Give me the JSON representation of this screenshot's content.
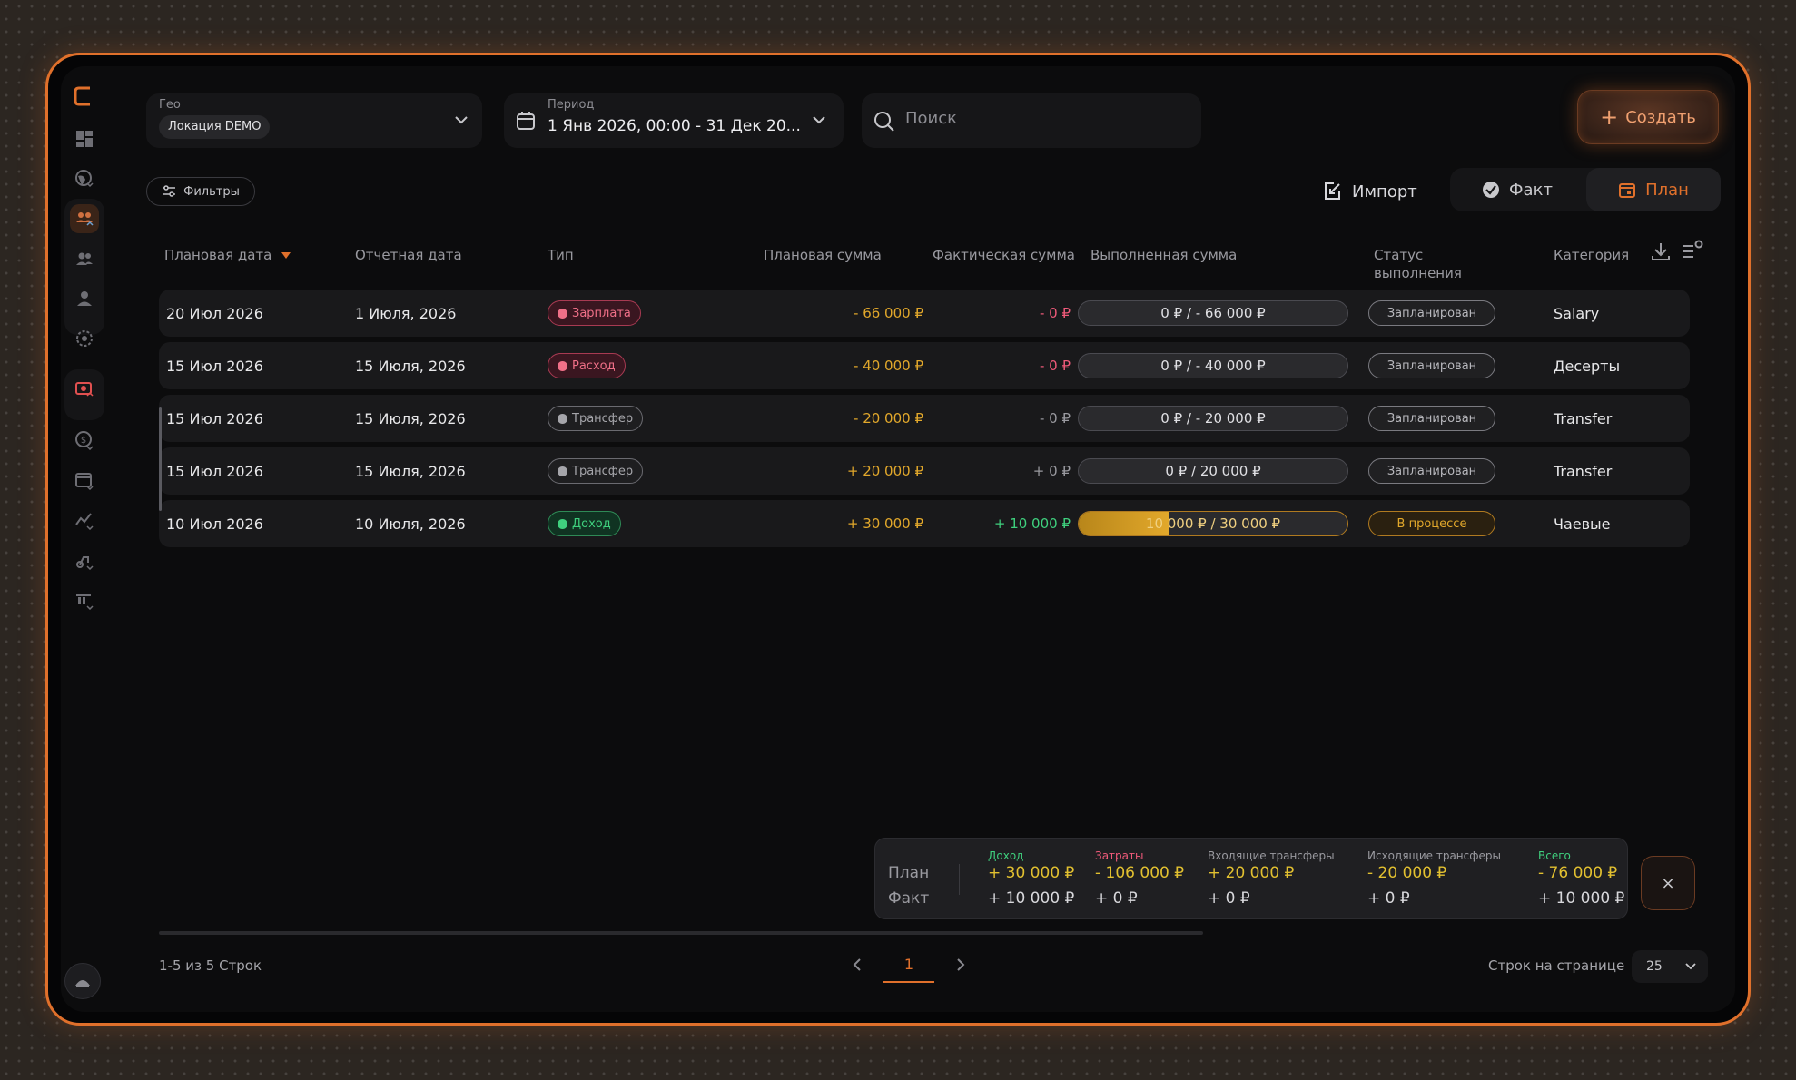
{
  "header": {
    "geo": {
      "label": "Гео",
      "value": "Локация DEMO"
    },
    "period": {
      "label": "Период",
      "value": "1 Янв 2026, 00:00 - 31 Дек 20..."
    },
    "search": {
      "placeholder": "Поиск"
    },
    "create_label": "Создать"
  },
  "toolbar": {
    "filters_label": "Фильтры",
    "import_label": "Импорт",
    "fact_label": "Факт",
    "plan_label": "План",
    "active_mode": "План"
  },
  "table": {
    "headers": {
      "plan_date": "Плановая дата",
      "report_date": "Отчетная дата",
      "type": "Тип",
      "plan_sum": "Плановая сумма",
      "fact_sum": "Фактическая сумма",
      "done_sum": "Выполненная сумма",
      "status": "Статус выполнения",
      "category": "Категория"
    },
    "rows": [
      {
        "plan_date": "20 Июл 2026",
        "report_date": "1 Июля, 2026",
        "type": "Зарплата",
        "type_kind": "salary",
        "plan_sum": "- 66 000 ₽",
        "fact_sum": "- 0 ₽",
        "done": "0 ₽ / - 66 000 ₽",
        "progress": 0,
        "status": "Запланирован",
        "status_kind": "plan",
        "category": "Salary"
      },
      {
        "plan_date": "15 Июл 2026",
        "report_date": "15 Июля, 2026",
        "type": "Расход",
        "type_kind": "expense",
        "plan_sum": "- 40 000 ₽",
        "fact_sum": "- 0 ₽",
        "done": "0 ₽ / - 40 000 ₽",
        "progress": 0,
        "status": "Запланирован",
        "status_kind": "plan",
        "category": "Десерты"
      },
      {
        "plan_date": "15 Июл 2026",
        "report_date": "15 Июля, 2026",
        "type": "Трансфер",
        "type_kind": "transfer",
        "plan_sum": "- 20 000 ₽",
        "fact_sum": "- 0 ₽",
        "done": "0 ₽ / - 20 000 ₽",
        "progress": 0,
        "status": "Запланирован",
        "status_kind": "plan",
        "category": "Transfer"
      },
      {
        "plan_date": "15 Июл 2026",
        "report_date": "15 Июля, 2026",
        "type": "Трансфер",
        "type_kind": "transfer",
        "plan_sum": "+ 20 000 ₽",
        "fact_sum": "+ 0 ₽",
        "done": "0 ₽ / 20 000 ₽",
        "progress": 0,
        "status": "Запланирован",
        "status_kind": "plan",
        "category": "Transfer"
      },
      {
        "plan_date": "10 Июл 2026",
        "report_date": "10 Июля, 2026",
        "type": "Доход",
        "type_kind": "income",
        "plan_sum": "+ 30 000 ₽",
        "fact_sum": "+ 10 000 ₽",
        "done": "10 000 ₽ / 30 000 ₽",
        "progress": 0.333,
        "status": "В процессе",
        "status_kind": "progress",
        "category": "Чаевые"
      }
    ]
  },
  "summary": {
    "plan_label": "План",
    "fact_label": "Факт",
    "columns": [
      {
        "header": "Доход",
        "plan": "+ 30 000 ₽",
        "fact": "+ 10 000 ₽",
        "color": "#3fd07e"
      },
      {
        "header": "Затраты",
        "plan": "- 106 000 ₽",
        "fact": "+ 0 ₽",
        "color": "#f05a7a"
      },
      {
        "header": "Входящие трансферы",
        "plan": "+ 20 000 ₽",
        "fact": "+ 0 ₽",
        "color": "#9a9aa0"
      },
      {
        "header": "Исходящие трансферы",
        "plan": "- 20 000 ₽",
        "fact": "+ 0 ₽",
        "color": "#9a9aa0"
      },
      {
        "header": "Всего",
        "plan": "- 76 000 ₽",
        "fact": "+ 10 000 ₽",
        "color": "#3fd07e"
      }
    ],
    "close_label": "×"
  },
  "footer": {
    "range": "1-5 из 5 Строк",
    "page": "1",
    "rows_per_page_label": "Строк на странице",
    "rows_per_page": "25"
  },
  "colors": {
    "accent": "#e0702b",
    "warning": "#e2a82b",
    "negative": "#f05a7a",
    "positive": "#3fd07e"
  },
  "sidebar_icons": [
    "dashboard-icon",
    "globe-icon",
    "team-icon",
    "users-icon",
    "user-icon",
    "target-icon",
    "finance-icon",
    "currency-icon",
    "calendar-icon",
    "chart-icon",
    "delivery-icon",
    "warehouse-icon"
  ]
}
